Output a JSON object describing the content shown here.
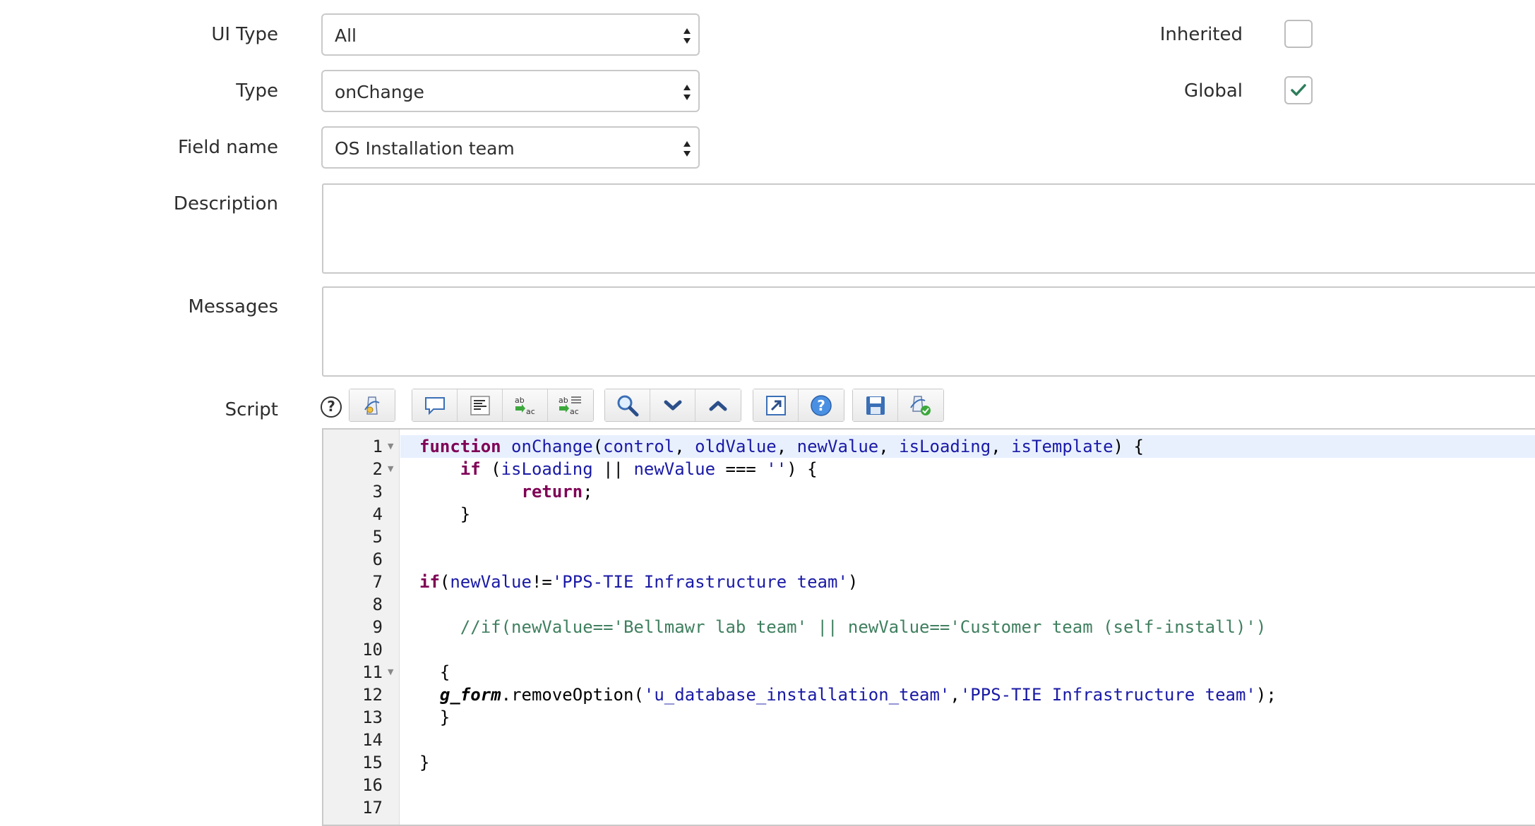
{
  "form": {
    "ui_type": {
      "label": "UI Type",
      "value": "All"
    },
    "type": {
      "label": "Type",
      "value": "onChange"
    },
    "field_name": {
      "label": "Field name",
      "value": "OS Installation team"
    },
    "description": {
      "label": "Description",
      "value": ""
    },
    "messages": {
      "label": "Messages",
      "value": ""
    },
    "script": {
      "label": "Script"
    },
    "inherited": {
      "label": "Inherited",
      "checked": false
    },
    "global": {
      "label": "Global",
      "checked": true
    },
    "help_glyph": "?"
  },
  "toolbar": {
    "groups": [
      [
        "script-format-icon"
      ],
      [
        "comment-icon",
        "format-text-icon",
        "replace-icon",
        "replace-all-icon"
      ],
      [
        "search-icon",
        "next-icon",
        "previous-icon"
      ],
      [
        "fullscreen-icon",
        "help-icon"
      ],
      [
        "save-icon",
        "script-check-icon"
      ]
    ]
  },
  "editor": {
    "line_numbers": [
      "1",
      "2",
      "3",
      "4",
      "5",
      "6",
      "7",
      "8",
      "9",
      "10",
      "11",
      "12",
      "13",
      "14",
      "15",
      "16",
      "17"
    ],
    "code": {
      "l1": {
        "kw": "function",
        "fn": "onChange",
        "p1": "control",
        "p2": "oldValue",
        "p3": "newValue",
        "p4": "isLoading",
        "p5": "isTemplate"
      },
      "l2": {
        "kw": "if",
        "v1": "isLoading",
        "v2": "newValue",
        "s": "''"
      },
      "l3": {
        "kw": "return"
      },
      "l7": {
        "kw": "if",
        "v": "newValue",
        "s": "'PPS-TIE Infrastructure team'"
      },
      "l9": {
        "comment": "//if(newValue=='Bellmawr lab team' || newValue=='Customer team (self-install)')"
      },
      "l12": {
        "obj": "g_form",
        "method": "removeOption",
        "s1": "'u_database_installation_team'",
        "s2": "'PPS-TIE Infrastructure team'"
      }
    }
  },
  "colors": {
    "keyword": "#7f0055",
    "identifier": "#1a1aa6",
    "comment": "#3f7f5f",
    "checkmark": "#2e7d5b",
    "active_line": "#e8f0fe"
  }
}
